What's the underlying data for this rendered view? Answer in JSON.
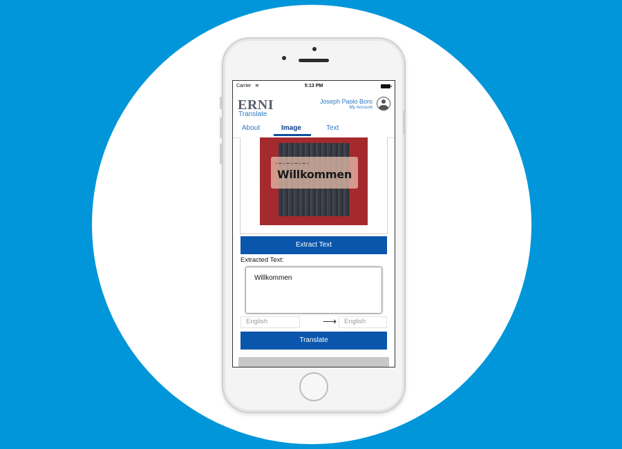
{
  "status_bar": {
    "carrier": "Carrier",
    "wifi_icon": "≋",
    "time": "5:13 PM"
  },
  "header": {
    "brand": "ERNI",
    "brand_sub": "Translate",
    "user_name": "Joseph Paolo Boro",
    "account_link": "My Account"
  },
  "tabs": [
    {
      "label": "About"
    },
    {
      "label": "Image",
      "active": true
    },
    {
      "label": "Text"
    }
  ],
  "image_preview": {
    "sign_text": "Willkommen",
    "ornament": "◦∽◦∽◦∽◦∽◦"
  },
  "extract_button": "Extract Text",
  "extracted": {
    "label": "Extracted Text:",
    "value": "Willkommen"
  },
  "languages": {
    "from": "English",
    "arrow": "⟶",
    "to": "English"
  },
  "translate_button": "Translate",
  "colors": {
    "background": "#0096d9",
    "primary_button": "#0a56ac",
    "link": "#2b78c2"
  }
}
